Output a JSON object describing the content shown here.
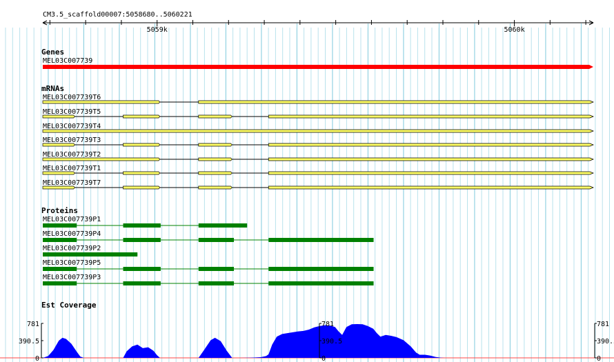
{
  "ruler": {
    "region_label": "CM3.5_scaffold00007:5058680..5060221",
    "start": 5058680,
    "end": 5060221,
    "major_ticks": [
      {
        "pos": 5059000,
        "label": "5059k"
      },
      {
        "pos": 5060000,
        "label": "5060k"
      }
    ]
  },
  "tracks": {
    "genes": {
      "title": "Genes",
      "color": "#ff0000",
      "features": [
        {
          "name": "MEL03C007739",
          "start": 5058680,
          "end": 5060221
        }
      ]
    },
    "mrnas": {
      "title": "mRNAs",
      "color": "#ffff66",
      "features": [
        {
          "name": "MEL03C007739T6",
          "exons": [
            [
              5058680,
              5059008
            ],
            [
              5059116,
              5060221
            ]
          ]
        },
        {
          "name": "MEL03C007739T5",
          "exons": [
            [
              5058680,
              5058770
            ],
            [
              5058905,
              5059008
            ],
            [
              5059116,
              5059210
            ],
            [
              5059312,
              5060221
            ]
          ]
        },
        {
          "name": "MEL03C007739T4",
          "exons": [
            [
              5058680,
              5060221
            ]
          ]
        },
        {
          "name": "MEL03C007739T3",
          "exons": [
            [
              5058680,
              5058770
            ],
            [
              5058905,
              5059008
            ],
            [
              5059116,
              5059210
            ],
            [
              5059312,
              5060221
            ]
          ]
        },
        {
          "name": "MEL03C007739T2",
          "exons": [
            [
              5058680,
              5059008
            ],
            [
              5059116,
              5059210
            ],
            [
              5059312,
              5060221
            ]
          ]
        },
        {
          "name": "MEL03C007739T1",
          "exons": [
            [
              5058680,
              5058770
            ],
            [
              5058905,
              5059008
            ],
            [
              5059116,
              5059210
            ],
            [
              5059312,
              5060221
            ]
          ]
        },
        {
          "name": "MEL03C007739T7",
          "exons": [
            [
              5058680,
              5058770
            ],
            [
              5058905,
              5059008
            ],
            [
              5059116,
              5059210
            ],
            [
              5059312,
              5060221
            ]
          ]
        }
      ]
    },
    "proteins": {
      "title": "Proteins",
      "color": "#008000",
      "features": [
        {
          "name": "MEL03C007739P1",
          "exons": [
            [
              5058680,
              5058775
            ],
            [
              5058905,
              5059010
            ],
            [
              5059116,
              5059252
            ]
          ]
        },
        {
          "name": "MEL03C007739P4",
          "exons": [
            [
              5058680,
              5058775
            ],
            [
              5058905,
              5059010
            ],
            [
              5059116,
              5059215
            ],
            [
              5059312,
              5059606
            ]
          ]
        },
        {
          "name": "MEL03C007739P2",
          "exons": [
            [
              5058680,
              5058945
            ]
          ]
        },
        {
          "name": "MEL03C007739P5",
          "exons": [
            [
              5058680,
              5058775
            ],
            [
              5058905,
              5059010
            ],
            [
              5059116,
              5059215
            ],
            [
              5059312,
              5059606
            ]
          ]
        },
        {
          "name": "MEL03C007739P3",
          "exons": [
            [
              5058680,
              5058775
            ],
            [
              5058905,
              5059010
            ],
            [
              5059116,
              5059215
            ],
            [
              5059312,
              5059606
            ]
          ]
        }
      ]
    },
    "coverage": {
      "title": "Est Coverage",
      "color": "#0000ff",
      "ymax": 781,
      "axis_labels": [
        "781",
        "390.5",
        "0"
      ],
      "points": [
        [
          5058680,
          0
        ],
        [
          5058695,
          40
        ],
        [
          5058710,
          180
        ],
        [
          5058725,
          390
        ],
        [
          5058735,
          455
        ],
        [
          5058745,
          430
        ],
        [
          5058760,
          320
        ],
        [
          5058775,
          140
        ],
        [
          5058785,
          30
        ],
        [
          5058795,
          0
        ],
        [
          5058905,
          0
        ],
        [
          5058915,
          150
        ],
        [
          5058930,
          260
        ],
        [
          5058945,
          300
        ],
        [
          5058960,
          220
        ],
        [
          5058975,
          240
        ],
        [
          5058990,
          160
        ],
        [
          5059000,
          60
        ],
        [
          5059008,
          0
        ],
        [
          5059116,
          0
        ],
        [
          5059130,
          160
        ],
        [
          5059150,
          400
        ],
        [
          5059162,
          455
        ],
        [
          5059178,
          380
        ],
        [
          5059195,
          160
        ],
        [
          5059210,
          0
        ],
        [
          5059230,
          0
        ],
        [
          5059260,
          5
        ],
        [
          5059290,
          15
        ],
        [
          5059305,
          40
        ],
        [
          5059312,
          80
        ],
        [
          5059322,
          300
        ],
        [
          5059335,
          480
        ],
        [
          5059350,
          540
        ],
        [
          5059365,
          560
        ],
        [
          5059380,
          580
        ],
        [
          5059395,
          600
        ],
        [
          5059410,
          610
        ],
        [
          5059425,
          640
        ],
        [
          5059440,
          690
        ],
        [
          5059455,
          720
        ],
        [
          5059470,
          740
        ],
        [
          5059485,
          730
        ],
        [
          5059498,
          700
        ],
        [
          5059508,
          600
        ],
        [
          5059518,
          520
        ],
        [
          5059530,
          700
        ],
        [
          5059545,
          760
        ],
        [
          5059560,
          765
        ],
        [
          5059575,
          760
        ],
        [
          5059590,
          720
        ],
        [
          5059605,
          660
        ],
        [
          5059615,
          560
        ],
        [
          5059625,
          480
        ],
        [
          5059640,
          520
        ],
        [
          5059655,
          500
        ],
        [
          5059670,
          470
        ],
        [
          5059690,
          400
        ],
        [
          5059710,
          260
        ],
        [
          5059725,
          120
        ],
        [
          5059735,
          70
        ],
        [
          5059750,
          70
        ],
        [
          5059765,
          50
        ],
        [
          5059780,
          20
        ],
        [
          5059795,
          5
        ],
        [
          5059805,
          0
        ],
        [
          5059870,
          0
        ]
      ]
    }
  }
}
